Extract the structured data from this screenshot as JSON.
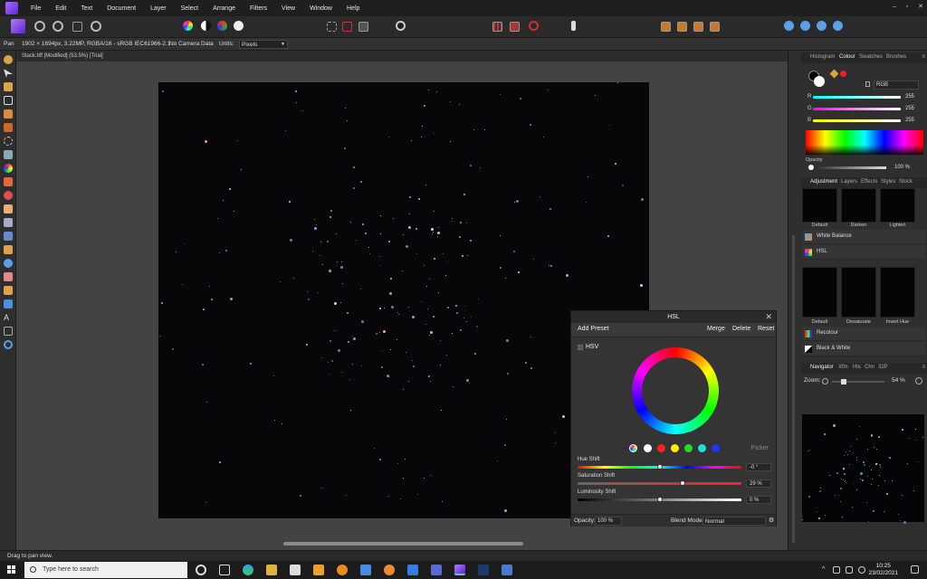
{
  "menubar": {
    "items": [
      "File",
      "Edit",
      "Text",
      "Document",
      "Layer",
      "Select",
      "Arrange",
      "Filters",
      "View",
      "Window",
      "Help"
    ],
    "window_controls": [
      "–",
      "▫",
      "✕"
    ]
  },
  "contextbar": {
    "tool": "Pan",
    "info": "1902 × 1694px, 3.22MP, RGBA/16 - sRGB IEC61966-2.1",
    "camera": "No Camera Data",
    "units_label": "Units:",
    "units_value": "Pixels"
  },
  "document": {
    "tab_title": "Stack.tiff [Modified] (53.5%) [Trial]"
  },
  "hsl_dialog": {
    "title": "HSL",
    "add_preset": "Add Preset",
    "merge": "Merge",
    "delete": "Delete",
    "reset": "Reset",
    "hsv_label": "HSV",
    "picker": "Picker",
    "swatch_colors": [
      "#ffffff",
      "#ff2020",
      "#ffee00",
      "#22dd22",
      "#22dddd",
      "#2233ff",
      "#ee22ee"
    ],
    "hue_shift": {
      "label": "Hue Shift",
      "value": "-0 °",
      "fraction": 0.5
    },
    "saturation_shift": {
      "label": "Saturation Shift",
      "value": "29 %",
      "fraction": 0.64
    },
    "luminosity_shift": {
      "label": "Luminosity Shift",
      "value": "0 %",
      "fraction": 0.5
    },
    "opacity_label": "Opacity:",
    "opacity_value": "100 %",
    "blend_label": "Blend Mode:",
    "blend_value": "Normal"
  },
  "colour_panel": {
    "tabs": [
      "Histogram",
      "Colour",
      "Swatches",
      "Brushes"
    ],
    "active_tab": "Colour",
    "model": "RGB",
    "r": {
      "label": "R",
      "value": "255"
    },
    "g": {
      "label": "G",
      "value": "255"
    },
    "b": {
      "label": "B",
      "value": "255"
    },
    "opacity_label": "Opacity",
    "opacity_value": "100 %"
  },
  "adjustment_panel": {
    "tabs": [
      "Adjustment",
      "Layers",
      "Effects",
      "Styles",
      "Stock"
    ],
    "active_tab": "Adjustment",
    "presets_top": [
      "Default",
      "Darken",
      "Lighten"
    ],
    "item_white_balance": "White Balance",
    "item_hsl": "HSL",
    "presets_hsl": [
      "Default",
      "Desaturate",
      "Invert Hue"
    ],
    "item_recolour": "Recolour",
    "item_bw": "Black & White"
  },
  "navigator_panel": {
    "tabs": [
      "Navigator",
      "Xfm",
      "His",
      "Chn",
      "32P"
    ],
    "active_tab": "Navigator",
    "zoom_label": "Zoom:",
    "zoom_value": "54 %"
  },
  "statusbar": {
    "text": "Drag to pan view."
  },
  "taskbar": {
    "search_placeholder": "Type here to search",
    "time": "10:25",
    "date": "23/02/2021"
  },
  "colors": {
    "accent": "#6c3ad6",
    "canvas_bg": "#07070a"
  }
}
